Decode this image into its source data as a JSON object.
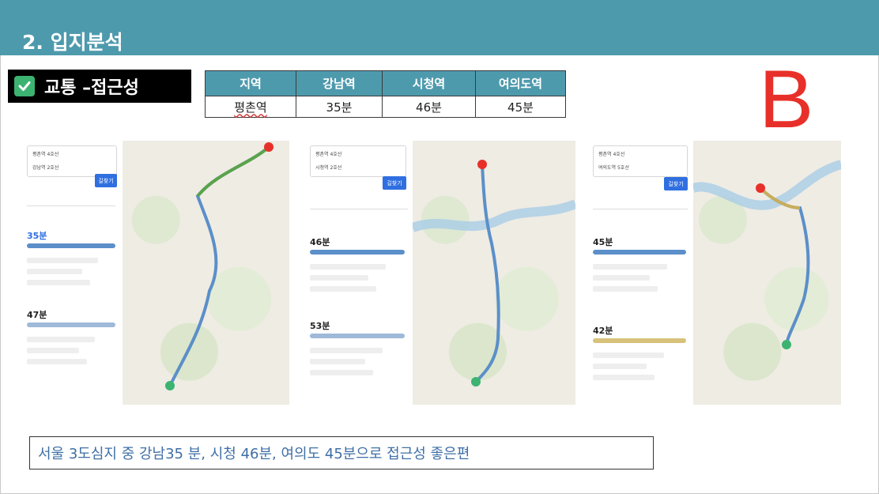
{
  "header": {
    "title": "2. 입지분석"
  },
  "section": {
    "label": "교통 –접근성",
    "icon": "check-icon"
  },
  "marker": {
    "letter": "B",
    "color": "#e8302a"
  },
  "table": {
    "headers": [
      "지역",
      "강남역",
      "시청역",
      "여의도역"
    ],
    "row": [
      "평촌역",
      "35분",
      "46분",
      "45분"
    ]
  },
  "screenshots": [
    {
      "id": "gangnam",
      "from": "평촌역 4호선",
      "to": "강남역 2호선",
      "first_time": "35분",
      "second_time": "47분",
      "search": "길찾기"
    },
    {
      "id": "cityhall",
      "from": "평촌역 4호선",
      "to": "시청역 2호선",
      "first_time": "46분",
      "second_time": "53분",
      "search": "길찾기"
    },
    {
      "id": "yeouido",
      "from": "평촌역 4호선",
      "to": "여의도역 5호선",
      "first_time": "45분",
      "second_time": "42분",
      "search": "길찾기"
    }
  ],
  "note": {
    "text": "서울 3도심지 중 강남35 분, 시청 46분, 여의도 45분으로 접근성 좋은편"
  },
  "colors": {
    "header": "#4e9aad",
    "route": "#5b8fc9",
    "note_text": "#3f6fa6"
  }
}
